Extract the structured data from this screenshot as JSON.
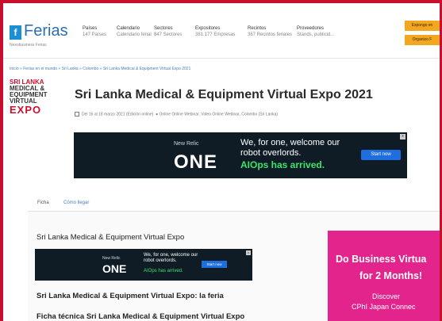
{
  "header": {
    "logo_icon": "f",
    "logo_text": "Ferias",
    "logo_tagline": "Nexobusiness Ferias",
    "nav": [
      {
        "title": "Países",
        "sub": "147 Países"
      },
      {
        "title": "Calendario",
        "sub": "Calendario ferial"
      },
      {
        "title": "Sectores",
        "sub": "847 Sectores"
      },
      {
        "title": "Expositores",
        "sub": "381.177 Empresas"
      },
      {
        "title": "Recintos",
        "sub": "367 Recintos feriales"
      },
      {
        "title": "Proveedores",
        "sub": "Stands, publicid..."
      }
    ],
    "cta_top": "Expongo en",
    "cta_bottom": "Organizo F"
  },
  "breadcrumb": "Inicio » Ferias en el mundo » Sri Lanka » Colombo » Sri Lanka Medical & Equipment Virtual Expo 2021",
  "fair_logo": {
    "l1": "SRI LANKA",
    "l2": "MEDICAL &",
    "l3": "EQUIPMENT",
    "l4": "VIRTUAL",
    "l5": "EXPO"
  },
  "title": "Sri Lanka Medical & Equipment Virtual Expo 2021",
  "meta": {
    "date": "Del 16 al 18 marzo 2021 (Edición online)",
    "location": "Online Online Webinar, Video Online Webinar, Colombo (Sri Lanka)"
  },
  "ad_big": {
    "brand_small": "New Relic",
    "brand_big": "ONE",
    "msg1": "We, for one, welcome our robot overlords.",
    "msg2": "AIOps has arrived.",
    "button": "Start now",
    "close": "x"
  },
  "tabs": [
    {
      "label": "Ficha"
    },
    {
      "label": "Cómo llegar"
    }
  ],
  "section_title": "Sri Lanka Medical & Equipment Virtual Expo",
  "ad_small": {
    "brand_small": "New Relic",
    "brand_big": "ONE",
    "msg1": "We, for one, welcome our robot overlords.",
    "msg2": "AIOps has arrived.",
    "button": "Start now",
    "close": "x"
  },
  "h2": "Sri Lanka Medical & Equipment Virtual Expo: la feria",
  "h3": "Ficha técnica Sri Lanka Medical & Equipment Virtual Expo",
  "side_ad": {
    "l1": "Do Business Virtua",
    "l2": "for 2 Months!",
    "l3": "Discover",
    "l4": "CPhI Japan Connec"
  }
}
